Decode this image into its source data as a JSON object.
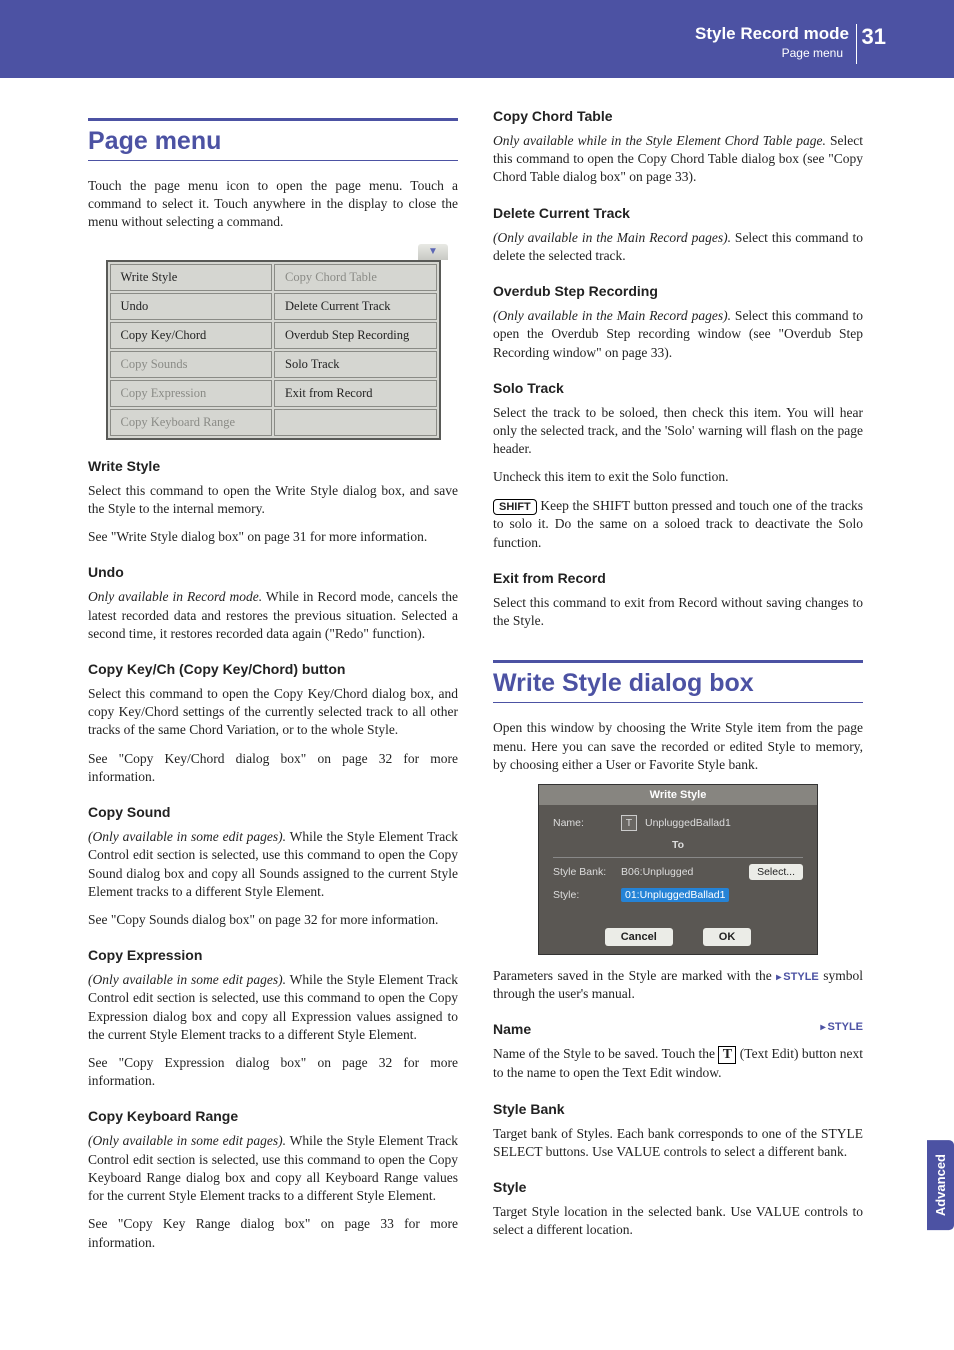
{
  "header": {
    "title": "Style Record mode",
    "subtitle": "Page menu",
    "pagenum": "31"
  },
  "sideTab": "Advanced",
  "left": {
    "h1": "Page menu",
    "intro": "Touch the page menu icon to open the page menu. Touch a command to select it. Touch anywhere in the display to close the menu without selecting a command.",
    "menu": {
      "r1c1": "Write Style",
      "r1c2": "Copy Chord Table",
      "r2c1": "Undo",
      "r2c2": "Delete Current Track",
      "r3c1": "Copy Key/Chord",
      "r3c2": "Overdub Step Recording",
      "r4c1": "Copy Sounds",
      "r4c2": "Solo Track",
      "r5c1": "Copy Expression",
      "r5c2": "Exit from Record",
      "r6c1": "Copy Keyboard Range"
    },
    "writeStyle": {
      "h": "Write Style",
      "p1": "Select this command to open the Write Style dialog box, and save the Style to the internal memory.",
      "p2": "See \"Write Style dialog box\" on page 31 for more information."
    },
    "undo": {
      "h": "Undo",
      "p1a": "Only available in Record mode.",
      "p1b": " While in Record mode, cancels the latest recorded data and restores the previous situation. Selected a second time, it restores recorded data again (\"Redo\" function)."
    },
    "copyKey": {
      "h": "Copy Key/Ch (Copy Key/Chord) button",
      "p1": "Select this command to open the Copy Key/Chord dialog box, and copy Key/Chord settings of the currently selected track to all other tracks of the same Chord Variation, or to the whole Style.",
      "p2": "See \"Copy Key/Chord dialog box\" on page 32 for more information."
    },
    "copySound": {
      "h": "Copy Sound",
      "p1a": "(Only available in some edit pages).",
      "p1b": " While the Style Element Track Control edit section is selected, use this command to open the Copy Sound dialog box and copy all Sounds assigned to the current Style Element tracks to a different Style Element.",
      "p2": "See \"Copy Sounds dialog box\" on page 32 for more information."
    },
    "copyExpr": {
      "h": "Copy Expression",
      "p1a": "(Only available in some edit pages).",
      "p1b": " While the Style Element Track Control edit section is selected, use this command to open the Copy Expression dialog box and copy all Expression values assigned to the current Style Element tracks to a different Style Element.",
      "p2": "See \"Copy Expression dialog box\" on page 32 for more information."
    },
    "copyKbd": {
      "h": "Copy Keyboard Range",
      "p1a": "(Only available in some edit pages).",
      "p1b": " While the Style Element Track Control edit section is selected, use this command to open the Copy Keyboard Range dialog box and copy all Keyboard Range values for the current Style Element tracks to a different Style Element.",
      "p2": "See \"Copy Key Range dialog box\" on page 33 for more information."
    }
  },
  "right": {
    "copyChord": {
      "h": "Copy Chord Table",
      "p1a": "Only available while in the Style Element Chord Table page.",
      "p1b": " Select this command to open the Copy Chord Table dialog box (see \"Copy Chord Table dialog box\" on page 33)."
    },
    "delTrack": {
      "h": "Delete Current Track",
      "p1a": "(Only available in the Main Record pages).",
      "p1b": " Select this command to delete the selected track."
    },
    "overdub": {
      "h": "Overdub Step Recording",
      "p1a": "(Only available in the Main Record pages).",
      "p1b": " Select this command to open the Overdub Step recording window (see \"Overdub Step Recording window\" on page 33)."
    },
    "solo": {
      "h": "Solo Track",
      "p1": "Select the track to be soloed, then check this item. You will hear only the selected track, and the 'Solo' warning will flash on the page header.",
      "p2": "Uncheck this item to exit the Solo function.",
      "shift": "SHIFT",
      "p3": " Keep the SHIFT button pressed and touch one of the tracks to solo it. Do the same on a soloed track to deactivate the Solo function."
    },
    "exit": {
      "h": "Exit from Record",
      "p1": "Select this command to exit from Record without saving changes to the Style."
    },
    "h1": "Write Style dialog box",
    "wsIntro": "Open this window by choosing the Write Style item from the page menu. Here you can save the recorded or edited Style to memory, by choosing either a User or Favorite Style bank.",
    "dialog": {
      "title": "Write Style",
      "nameLbl": "Name:",
      "nameVal": "UnpluggedBallad1",
      "to": "To",
      "bankLbl": "Style Bank:",
      "bankVal": "B06:Unplugged",
      "styleLbl": "Style:",
      "styleVal": "01:UnpluggedBallad1",
      "select": "Select...",
      "cancel": "Cancel",
      "ok": "OK"
    },
    "paramNote1": "Parameters saved in the Style are marked with the ",
    "paramNote2": "STYLE",
    "paramNote3": " symbol through the user's manual.",
    "name": {
      "h": "Name",
      "marker": "STYLE",
      "p1a": "Name of the Style to be saved. Touch the ",
      "p1b": " (Text Edit) button next to the name to open the Text Edit window."
    },
    "styleBank": {
      "h": "Style Bank",
      "p1": "Target bank of Styles. Each bank corresponds to one of the STYLE SELECT buttons. Use VALUE controls to select a different bank."
    },
    "style": {
      "h": "Style",
      "p1": "Target Style location in the selected bank. Use VALUE controls to select a different location."
    }
  }
}
